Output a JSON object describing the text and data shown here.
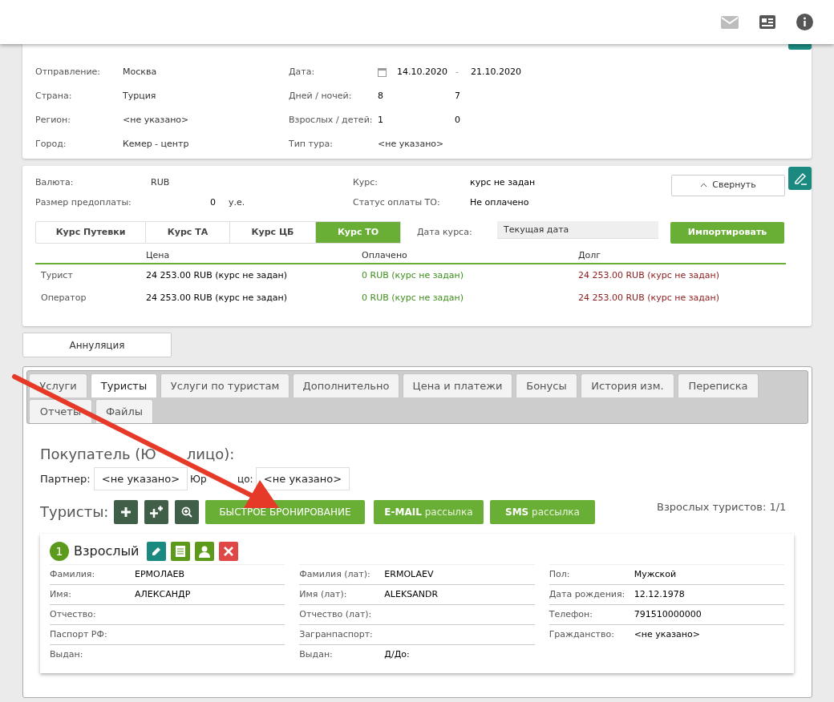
{
  "trip": {
    "rows": [
      {
        "left": {
          "label": "Отправление:",
          "value": "Москва"
        },
        "right": {
          "kind": "date",
          "label": "Дата:",
          "from": "14.10.2020",
          "separator": "-",
          "to": "21.10.2020"
        }
      },
      {
        "left": {
          "label": "Страна:",
          "value": "Турция"
        },
        "right": {
          "kind": "pair",
          "label": "Дней / ночей:",
          "values": [
            "8",
            "7"
          ]
        }
      },
      {
        "left": {
          "label": "Регион:",
          "value": "<не указано>"
        },
        "right": {
          "kind": "pair",
          "label": "Взрослых / детей:",
          "values": [
            "1",
            "0"
          ]
        }
      },
      {
        "left": {
          "label": "Город:",
          "value": "Кемер - центр"
        },
        "right": {
          "kind": "plain",
          "label": "Тип тура:",
          "value": "<не указано>"
        }
      }
    ]
  },
  "payment": {
    "currency": {
      "label": "Валюта:",
      "value": "RUB"
    },
    "rate": {
      "label": "Курс:",
      "value": "курс не задан"
    },
    "collapse_button": "Свернуть",
    "prepay": {
      "label": "Размер предоплаты:",
      "value": "0",
      "unit": "у.е."
    },
    "status": {
      "label": "Статус оплаты ТО:",
      "value": "Не оплачено"
    },
    "rate_tabs": [
      {
        "label": "Курс Путевки",
        "selected": false
      },
      {
        "label": "Курс ТА",
        "selected": false
      },
      {
        "label": "Курс ЦБ",
        "selected": false
      },
      {
        "label": "Курс ТО",
        "selected": true
      }
    ],
    "rate_date": {
      "label": "Дата курса:",
      "value": "Текущая дата"
    },
    "import_button": "Импортировать",
    "table": {
      "columns": [
        "Цена",
        "Оплачено",
        "Долг"
      ],
      "rows": [
        {
          "name": "Турист",
          "price": "24 253.00 RUB (курс не задан)",
          "paid": "0 RUB (курс не задан)",
          "debt": "24 253.00 RUB (курс не задан)"
        },
        {
          "name": "Оператор",
          "price": "24 253.00 RUB (курс не задан)",
          "paid": "0 RUB (курс не задан)",
          "debt": "24 253.00 RUB (курс не задан)"
        }
      ]
    }
  },
  "annul_button": "Аннуляция",
  "tabs": [
    {
      "label": "Услуги",
      "selected": false
    },
    {
      "label": "Туристы",
      "selected": true
    },
    {
      "label": "Услуги по туристам",
      "selected": false
    },
    {
      "label": "Дополнительно",
      "selected": false
    },
    {
      "label": "Цена и платежи",
      "selected": false
    },
    {
      "label": "Бонусы",
      "selected": false
    },
    {
      "label": "История изм.",
      "selected": false
    },
    {
      "label": "Переписка",
      "selected": false
    },
    {
      "label": "Отчеты",
      "selected": false
    },
    {
      "label": "Файлы",
      "selected": false
    }
  ],
  "buyer": {
    "title_parts": [
      "Покупатель (Ю",
      "лицо):"
    ],
    "partner": {
      "label": "Партнер:",
      "value": "<не указано>"
    },
    "legal": {
      "label_parts": [
        "Юр",
        "цо:"
      ],
      "value": "<не указано>"
    }
  },
  "tourists": {
    "title": "Туристы:",
    "quick_booking": "БЫСТРОЕ БРОНИРОВАНИЕ",
    "email_button": {
      "bold": "E-MAIL",
      "rest": "рассылка"
    },
    "sms_button": {
      "bold": "SMS",
      "rest": "рассылка"
    },
    "count": "Взрослых туристов: 1/1"
  },
  "tourist": {
    "number": "1",
    "type": "Взрослый",
    "columns": [
      [
        {
          "label": "Фамилия:",
          "value": "ЕРМОЛАЕВ"
        },
        {
          "label": "Имя:",
          "value": "АЛЕКСАНДР"
        },
        {
          "label": "Отчество:"
        },
        {
          "label": "Паспорт РФ:"
        },
        {
          "label": "Выдан:"
        }
      ],
      [
        {
          "label": "Фамилия (лат):",
          "value": "ERMOLAEV"
        },
        {
          "label": "Имя (лат):",
          "value": "ALEKSANDR"
        },
        {
          "label": "Отчество (лат):"
        },
        {
          "label": "Загранпаспорт:"
        },
        {
          "label": "Выдан:",
          "extra_label": "Д/До:"
        }
      ],
      [
        {
          "label": "Пол:",
          "value": "Мужской"
        },
        {
          "label": "Дата рождения:",
          "value": "12.12.1978"
        },
        {
          "label": "Телефон:",
          "value": "791510000000"
        },
        {
          "label": "Гражданство:",
          "value": "<не указано>"
        }
      ]
    ]
  }
}
